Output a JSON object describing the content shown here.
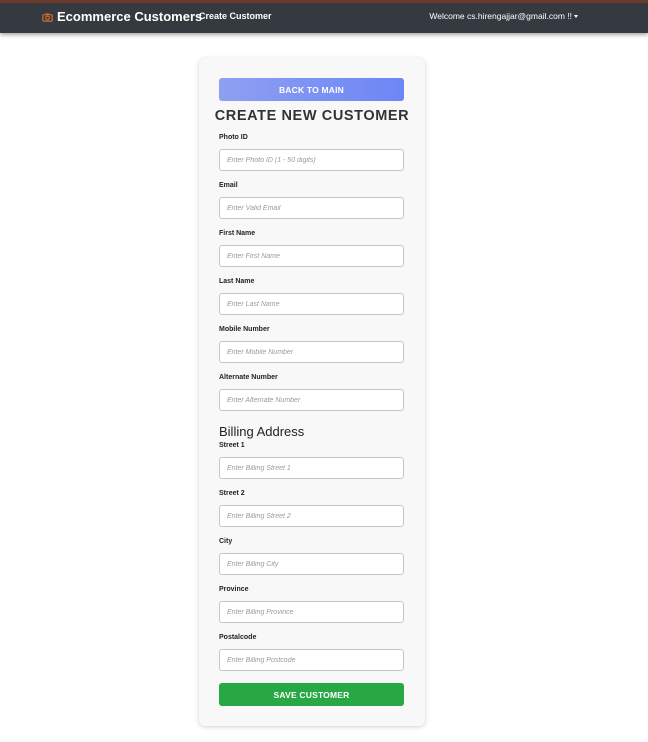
{
  "navbar": {
    "brand": "Ecommerce Customers",
    "brand_icon": "camera-icon",
    "link": "Create Customer",
    "welcome": "Welcome cs.hirengajjar@gmail.com !!"
  },
  "form": {
    "back_label": "BACK TO MAIN",
    "title": "CREATE NEW CUSTOMER",
    "fields": [
      {
        "label": "Photo ID",
        "placeholder": "Enter Photo ID (1 - 50 digits)"
      },
      {
        "label": "Email",
        "placeholder": "Enter Valid Email"
      },
      {
        "label": "First Name",
        "placeholder": "Enter First Name"
      },
      {
        "label": "Last Name",
        "placeholder": "Enter Last Name"
      },
      {
        "label": "Mobile Number",
        "placeholder": "Enter Mobile Number"
      },
      {
        "label": "Alternate Number",
        "placeholder": "Enter Alternate Number"
      }
    ],
    "billing_title": "Billing Address",
    "billing_fields": [
      {
        "label": "Street 1",
        "placeholder": "Enter Billing Street 1"
      },
      {
        "label": "Street 2",
        "placeholder": "Enter Billing Street 2"
      },
      {
        "label": "City",
        "placeholder": "Enter Billing City"
      },
      {
        "label": "Province",
        "placeholder": "Enter Billing Province"
      },
      {
        "label": "Postalcode",
        "placeholder": "Enter Billing Postcode"
      }
    ],
    "save_label": "SAVE CUSTOMER"
  },
  "colors": {
    "navbar_bg": "#343a40",
    "back_button": "#7b93f4",
    "save_button": "#28a745"
  }
}
